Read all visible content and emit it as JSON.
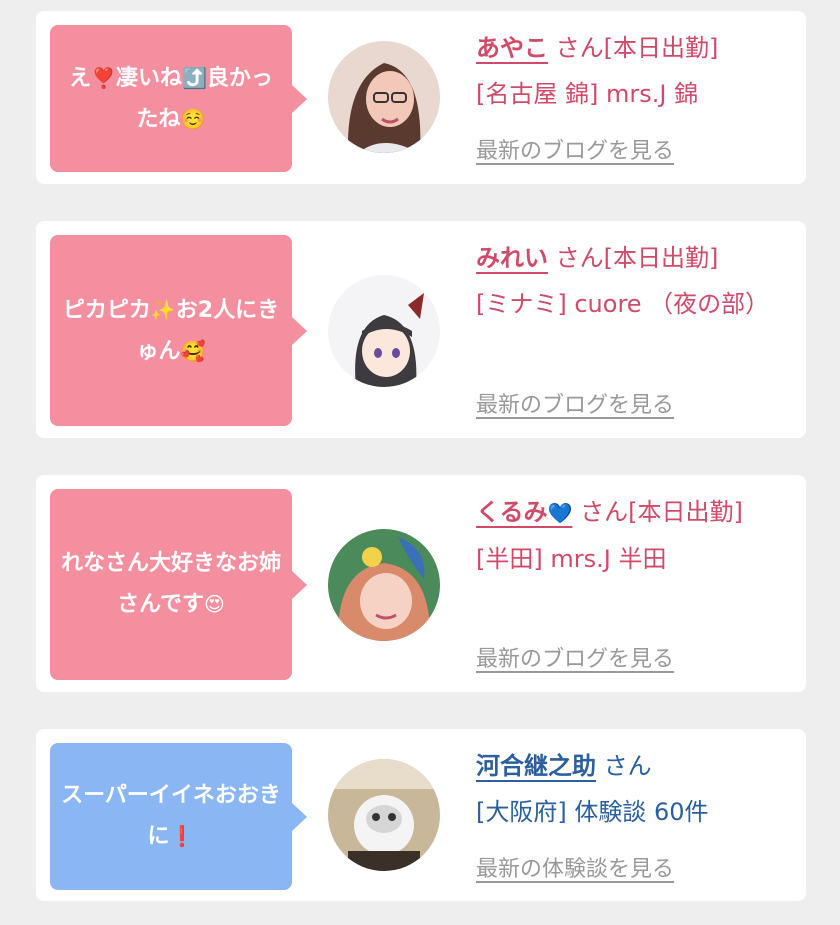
{
  "cards": [
    {
      "message_parts": [
        "え",
        "❣️",
        "凄いね",
        "⤴️",
        "良かったね",
        "☺️"
      ],
      "name": "あやこ",
      "suffix": "さん[本日出勤]",
      "shop": "[名古屋 錦] mrs.J 錦",
      "link": "最新のブログを見る",
      "theme": "pink"
    },
    {
      "message_parts": [
        "ピカピカ",
        "✨",
        "お2人にきゅん",
        "🥰"
      ],
      "name": "みれい",
      "suffix": "さん[本日出勤]",
      "shop": "[ミナミ] cuore （夜の部）",
      "link": "最新のブログを見る",
      "theme": "pink"
    },
    {
      "message_parts": [
        "れなさん大好きなお姉さんです",
        "😍"
      ],
      "name": "くるみ",
      "name_emoji": "💙",
      "suffix": "さん[本日出勤]",
      "shop": "[半田] mrs.J 半田",
      "link": "最新のブログを見る",
      "theme": "pink"
    },
    {
      "message_parts": [
        "スーパーイイネおおきに",
        "❗"
      ],
      "name": "河合継之助",
      "suffix": "さん",
      "shop": "[大阪府] 体験談 60件",
      "link": "最新の体験談を見る",
      "theme": "blue"
    }
  ],
  "colors": {
    "pink_bubble": "#f48fa0",
    "blue_bubble": "#8ab7f3",
    "pink_text": "#d14a6a",
    "blue_text": "#2b5f9e",
    "link_gray": "#999999"
  }
}
